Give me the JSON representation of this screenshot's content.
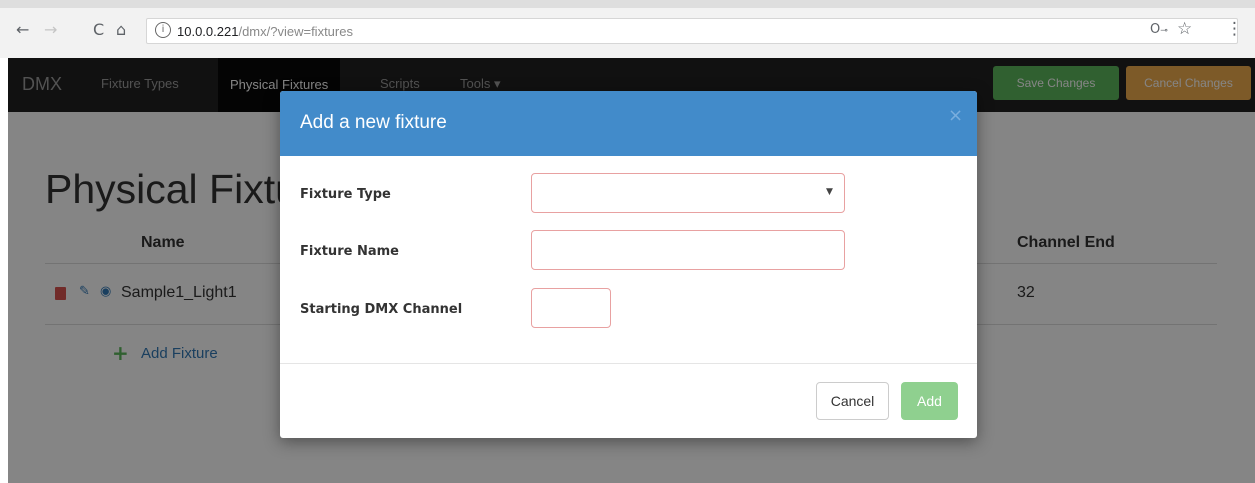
{
  "browser": {
    "back_icon": "←",
    "forward_icon": "→",
    "reload_icon": "C",
    "home_icon": "⌂",
    "info_icon": "i",
    "url_host": "10.0.0.221",
    "url_path": "/dmx/?view=fixtures",
    "key_icon": "🔑",
    "star_icon": "☆",
    "menu_icon": "⋮"
  },
  "navbar": {
    "brand": "DMX",
    "links": [
      "Fixture Types",
      "Physical Fixtures",
      "Scripts",
      "Tools ▾"
    ],
    "save_label": "Save Changes",
    "cancel_label": "Cancel Changes"
  },
  "page": {
    "title": "Physical Fixtures",
    "columns": [
      "Name",
      "Channel End"
    ],
    "rows": [
      {
        "name": "Sample1_Light1",
        "channel_end": "32"
      }
    ],
    "add_label": "Add Fixture"
  },
  "modal": {
    "title": "Add a new fixture",
    "close_icon": "×",
    "fixture_type_label": "Fixture Type",
    "fixture_type_value": "",
    "fixture_name_label": "Fixture Name",
    "fixture_name_value": "",
    "starting_channel_label": "Starting DMX Channel",
    "starting_channel_value": "",
    "cancel_label": "Cancel",
    "add_label": "Add"
  },
  "colors": {
    "modal_header": "#428bca",
    "save_button": "#5cb85c",
    "cancel_changes_button": "#f0ad4e",
    "add_button": "#8fd08f",
    "invalid_border": "#e8a1a1"
  }
}
